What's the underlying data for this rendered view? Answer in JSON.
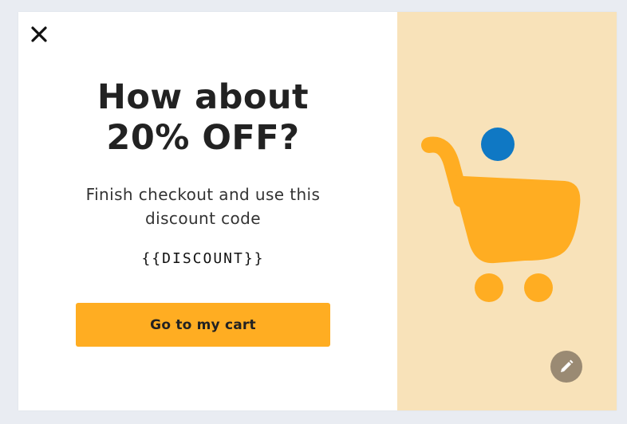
{
  "popup": {
    "headline_line1": "How about",
    "headline_line2": "20% OFF?",
    "subtext": "Finish checkout and use this discount code",
    "discount_code": "{{DISCOUNT}}",
    "cta_label": "Go to my cart"
  },
  "icons": {
    "close": "close-icon",
    "cart": "shopping-cart-icon",
    "item": "ball-icon",
    "edit": "pencil-icon"
  },
  "colors": {
    "accent": "#ffad22",
    "panel_bg": "#f8e2b9",
    "ball": "#0f78c4",
    "edit_button": "#9a8a73"
  }
}
